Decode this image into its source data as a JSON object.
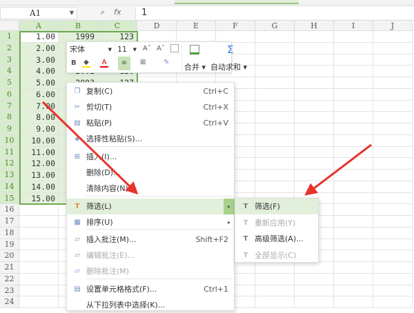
{
  "formula_bar": {
    "name_box": "A1",
    "fx_label": "fx",
    "zoom_icon": "magnifier-icon",
    "value": "1"
  },
  "columns": [
    "A",
    "B",
    "C",
    "D",
    "E",
    "F",
    "G",
    "H",
    "I",
    "J"
  ],
  "rows": [
    "1",
    "2",
    "3",
    "4",
    "5",
    "6",
    "7",
    "8",
    "9",
    "10",
    "11",
    "12",
    "13",
    "14",
    "15",
    "16",
    "17",
    "18",
    "19",
    "20",
    "21",
    "22",
    "23",
    "24"
  ],
  "col_a": [
    "1.00",
    "2.00",
    "3.00",
    "4.00",
    "5.00",
    "6.00",
    "7.00",
    "8.00",
    "9.00",
    "10.00",
    "11.00",
    "12.00",
    "13.00",
    "14.00",
    "15.00"
  ],
  "col_b": {
    "r1": "1999",
    "r4": "2002",
    "r5": "2003"
  },
  "col_c": {
    "r1": "123",
    "r4": "120",
    "r5": "127"
  },
  "mini_toolbar": {
    "font": "宋体",
    "size": "11",
    "bold": "B",
    "grow": "Aˆ",
    "shrink": "Aˇ",
    "merge": "合并",
    "autosum": "自动求和",
    "sigma": "Σ"
  },
  "context_menu": [
    {
      "label": "复制(C)",
      "shortcut": "Ctrl+C",
      "icon": "copy-icon"
    },
    {
      "label": "剪切(T)",
      "shortcut": "Ctrl+X",
      "icon": "scissors-icon"
    },
    {
      "label": "粘贴(P)",
      "shortcut": "Ctrl+V",
      "icon": "paste-icon"
    },
    {
      "label": "选择性粘贴(S)...",
      "shortcut": "",
      "icon": "paste-special-icon"
    },
    {
      "label": "插入(I)...",
      "shortcut": "",
      "icon": "insert-icon"
    },
    {
      "label": "删除(D)...",
      "shortcut": "",
      "icon": ""
    },
    {
      "label": "清除内容(N)",
      "shortcut": "",
      "icon": ""
    },
    {
      "label": "筛选(L)",
      "shortcut": "",
      "icon": "filter-icon"
    },
    {
      "label": "排序(U)",
      "shortcut": "",
      "icon": "sort-icon"
    },
    {
      "label": "插入批注(M)...",
      "shortcut": "Shift+F2",
      "icon": "comment-icon"
    },
    {
      "label": "编辑批注(E)...",
      "shortcut": "",
      "icon": "edit-comment-icon"
    },
    {
      "label": "删除批注(M)",
      "shortcut": "",
      "icon": "delete-comment-icon"
    },
    {
      "label": "设置单元格格式(F)...",
      "shortcut": "Ctrl+1",
      "icon": "format-cells-icon"
    },
    {
      "label": "从下拉列表中选择(K)...",
      "shortcut": "",
      "icon": ""
    }
  ],
  "submenu": [
    {
      "label": "筛选(F)"
    },
    {
      "label": "重新应用(Y)"
    },
    {
      "label": "高级筛选(A)..."
    },
    {
      "label": "全部显示(C)"
    }
  ],
  "colors": {
    "accent": "#6aab4a",
    "highlight": "#e2efda",
    "arrow": "#e8322b"
  }
}
